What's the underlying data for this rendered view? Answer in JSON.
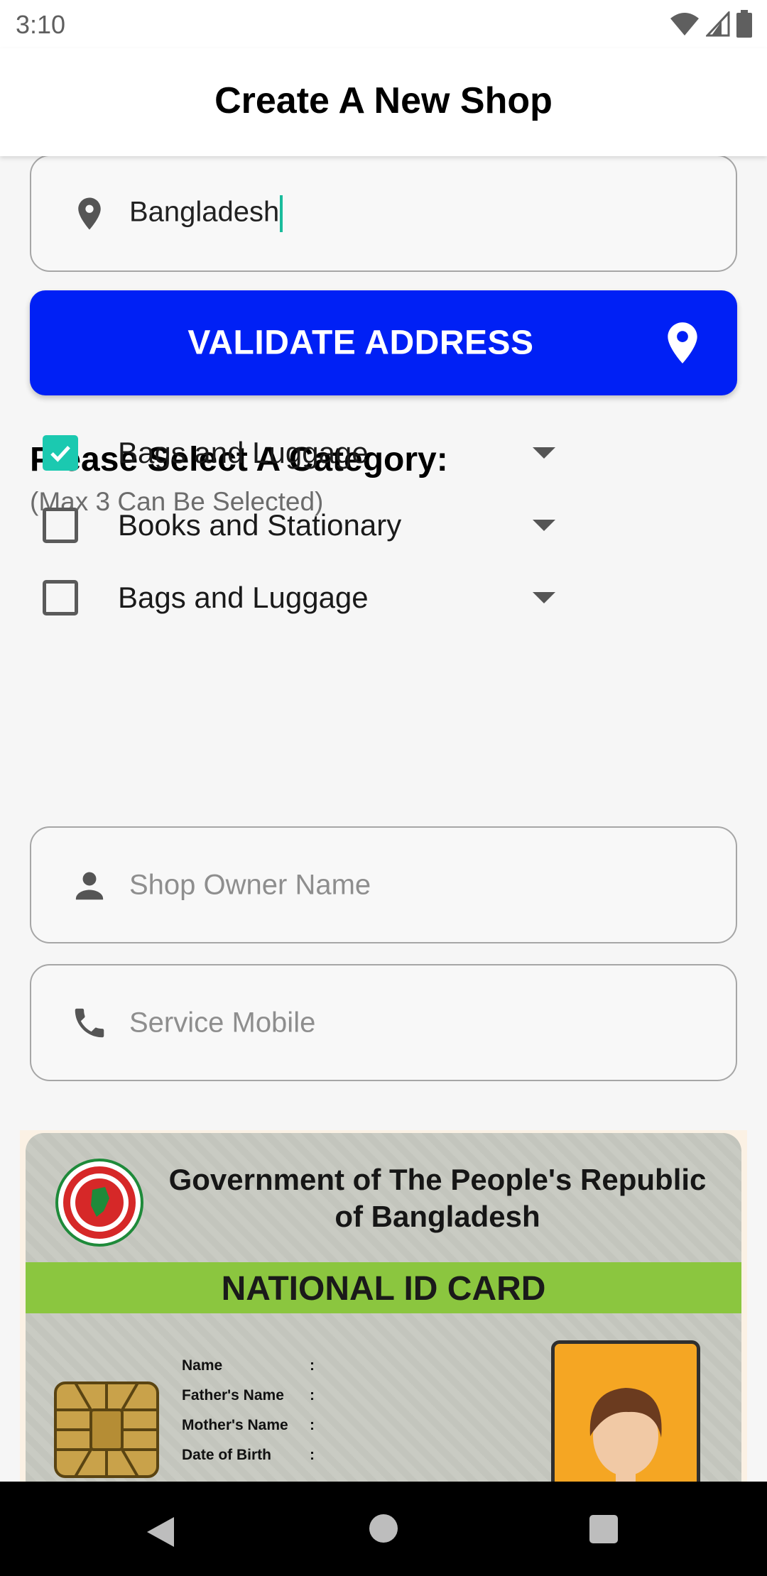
{
  "status_bar": {
    "time": "3:10",
    "icons": [
      "wifi-icon",
      "signal-icon",
      "battery-icon"
    ]
  },
  "app_bar": {
    "title": "Create A New Shop"
  },
  "address": {
    "value": "Bangladesh",
    "icon": "location-pin-icon"
  },
  "validate": {
    "label": "VALIDATE ADDRESS",
    "icon": "location-pin-icon"
  },
  "category": {
    "title": "Please Select A Category:",
    "subtitle": "(Max 3 Can Be Selected)",
    "items": [
      {
        "label": "Bags and Luggage",
        "checked": true
      },
      {
        "label": "Books and Stationary",
        "checked": false
      },
      {
        "label": "Bags and Luggage",
        "checked": false
      }
    ]
  },
  "owner_name": {
    "placeholder": "Shop Owner Name",
    "icon": "person-icon"
  },
  "service_mobile": {
    "placeholder": "Service Mobile",
    "icon": "phone-icon"
  },
  "id_card": {
    "gov_line1": "Government of The People's Republic",
    "gov_line2": "of Bangladesh",
    "title": "NATIONAL ID CARD",
    "fields": [
      "Name",
      "Father's Name",
      "Mother's Name",
      "Date of Birth"
    ],
    "separator": ":"
  },
  "colors": {
    "primary_button": "#0020f5",
    "checkbox_checked": "#1bc9b0",
    "id_band": "#8bc63f"
  },
  "nav_bar": {
    "icons": [
      "back-icon",
      "home-icon",
      "recents-icon"
    ]
  }
}
